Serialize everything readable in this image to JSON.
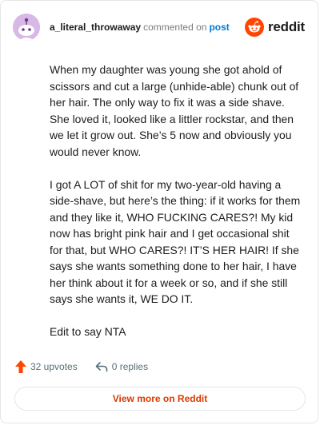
{
  "header": {
    "username": "a_literal_throwaway",
    "commented_on": "commented on",
    "post_link": "post",
    "brand_name": "reddit"
  },
  "comment": {
    "paragraphs": [
      "When my daughter was young she got ahold of scissors and cut a large (unhide-able) chunk out of her hair. The only way to fix it was a side shave. She loved it, looked like a littler rockstar, and then we let it grow out. She’s 5 now and obviously you would never know.",
      "I got A LOT of shit for my two-year-old having a side-shave, but here’s the thing: if it works for them and they like it, WHO FUCKING CARES?! My kid now has bright pink hair and I get occasional shit for that, but WHO CARES?! IT’S HER HAIR! If she says she wants something done to her hair, I have her think about it for a week or so, and if she still says she wants it, WE DO IT.",
      "Edit to say NTA"
    ]
  },
  "actions": {
    "upvotes": "32 upvotes",
    "replies": "0 replies"
  },
  "footer": {
    "view_more": "View more on Reddit"
  },
  "colors": {
    "brand_orange": "#ff4500",
    "link_blue": "#0079d3",
    "view_more_text": "#d93a00",
    "avatar_bg": "#d8b8e6"
  },
  "icons": {
    "avatar": "snoo-avatar-icon",
    "brand": "reddit-logo-icon",
    "upvote": "upvote-arrow-icon",
    "reply": "reply-arrow-icon"
  }
}
